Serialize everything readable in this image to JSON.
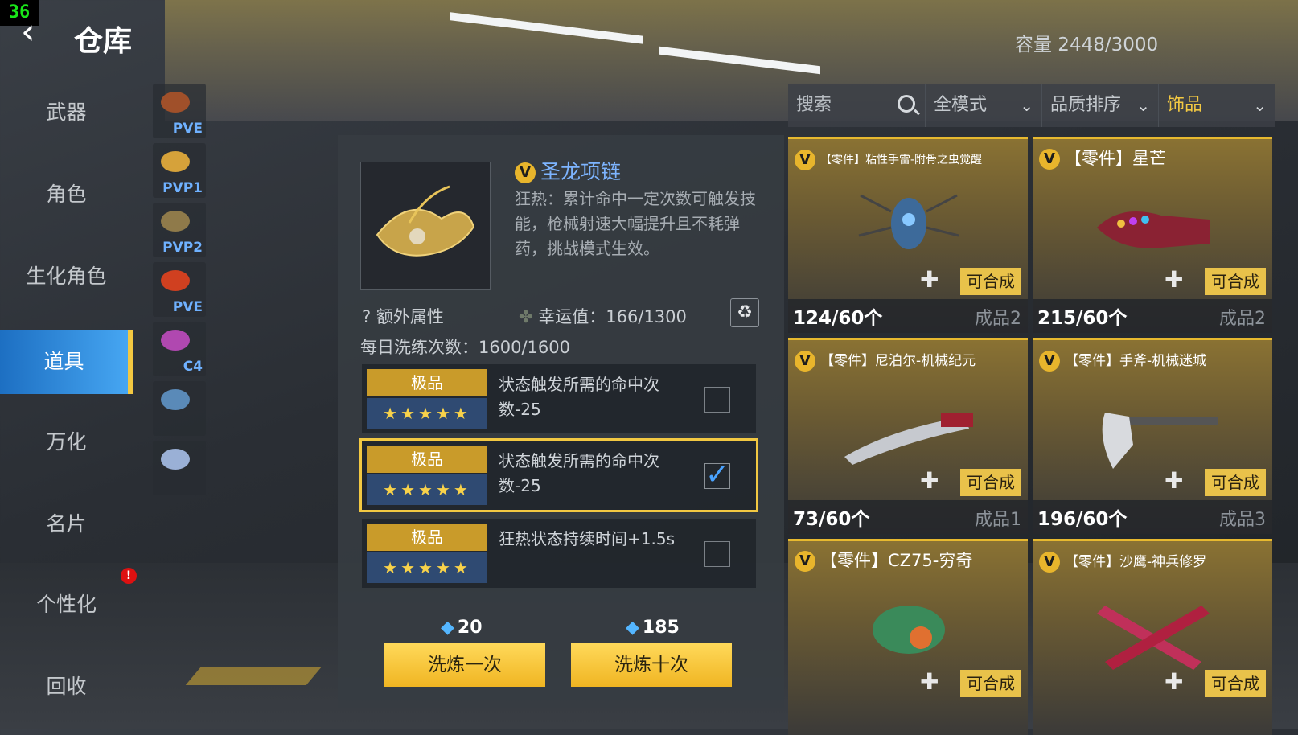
{
  "fps": "36",
  "header": {
    "title": "仓库",
    "capacity": "容量  2448/3000"
  },
  "sidebar": {
    "items": [
      {
        "label": "武器"
      },
      {
        "label": "角色"
      },
      {
        "label": "生化角色"
      },
      {
        "label": "道具",
        "active": true
      },
      {
        "label": "万化"
      },
      {
        "label": "名片"
      },
      {
        "label": "个性化"
      },
      {
        "label": "回收"
      }
    ]
  },
  "subtabs": [
    {
      "label": "PVE",
      "color": "#a0502a"
    },
    {
      "label": "PVP1",
      "color": "#d6a23a"
    },
    {
      "label": "PVP2",
      "color": "#8f7a4a"
    },
    {
      "label": "PVE",
      "color": "#d04020"
    },
    {
      "label": "C4",
      "color": "#b048b0"
    },
    {
      "label": "",
      "color": "#5a8ab8"
    },
    {
      "label": "",
      "color": "#9ab0d6"
    }
  ],
  "detail": {
    "badge": "V",
    "name": "圣龙项链",
    "description": "狂热：累计命中一定次数可触发技能，枪械射速大幅提升且不耗弹药，挑战模式生效。",
    "extra_label": "额外属性",
    "luck": "幸运值：166/1300",
    "daily": "每日洗练次数：1600/1600",
    "options": [
      {
        "grade": "极品",
        "stars": "★★★★★",
        "text": "状态触发所需的命中次数-25",
        "checked": false
      },
      {
        "grade": "极品",
        "stars": "★★★★★",
        "text": "状态触发所需的命中次数-25",
        "checked": true
      },
      {
        "grade": "极品",
        "stars": "★★★★★",
        "text": "狂热状态持续时间+1.5s",
        "checked": false
      }
    ],
    "price_once": "20",
    "price_ten": "185",
    "btn_once": "洗炼一次",
    "btn_ten": "洗炼十次"
  },
  "filter": {
    "search": "搜索",
    "mode": "全模式",
    "sort": "品质排序",
    "category": "饰品"
  },
  "cards": [
    {
      "name": "【零件】粘性手雷-附骨之虫觉醒",
      "count": "124/60个",
      "product": "成品2",
      "compose": "可合成"
    },
    {
      "name": "【零件】星芒",
      "count": "215/60个",
      "product": "成品2",
      "compose": "可合成"
    },
    {
      "name": "【零件】尼泊尔-机械纪元",
      "count": "73/60个",
      "product": "成品1",
      "compose": "可合成"
    },
    {
      "name": "【零件】手斧-机械迷城",
      "count": "196/60个",
      "product": "成品3",
      "compose": "可合成"
    },
    {
      "name": "【零件】CZ75-穷奇",
      "count": "",
      "product": "",
      "compose": "可合成"
    },
    {
      "name": "【零件】沙鹰-神兵修罗",
      "count": "",
      "product": "",
      "compose": "可合成"
    }
  ]
}
